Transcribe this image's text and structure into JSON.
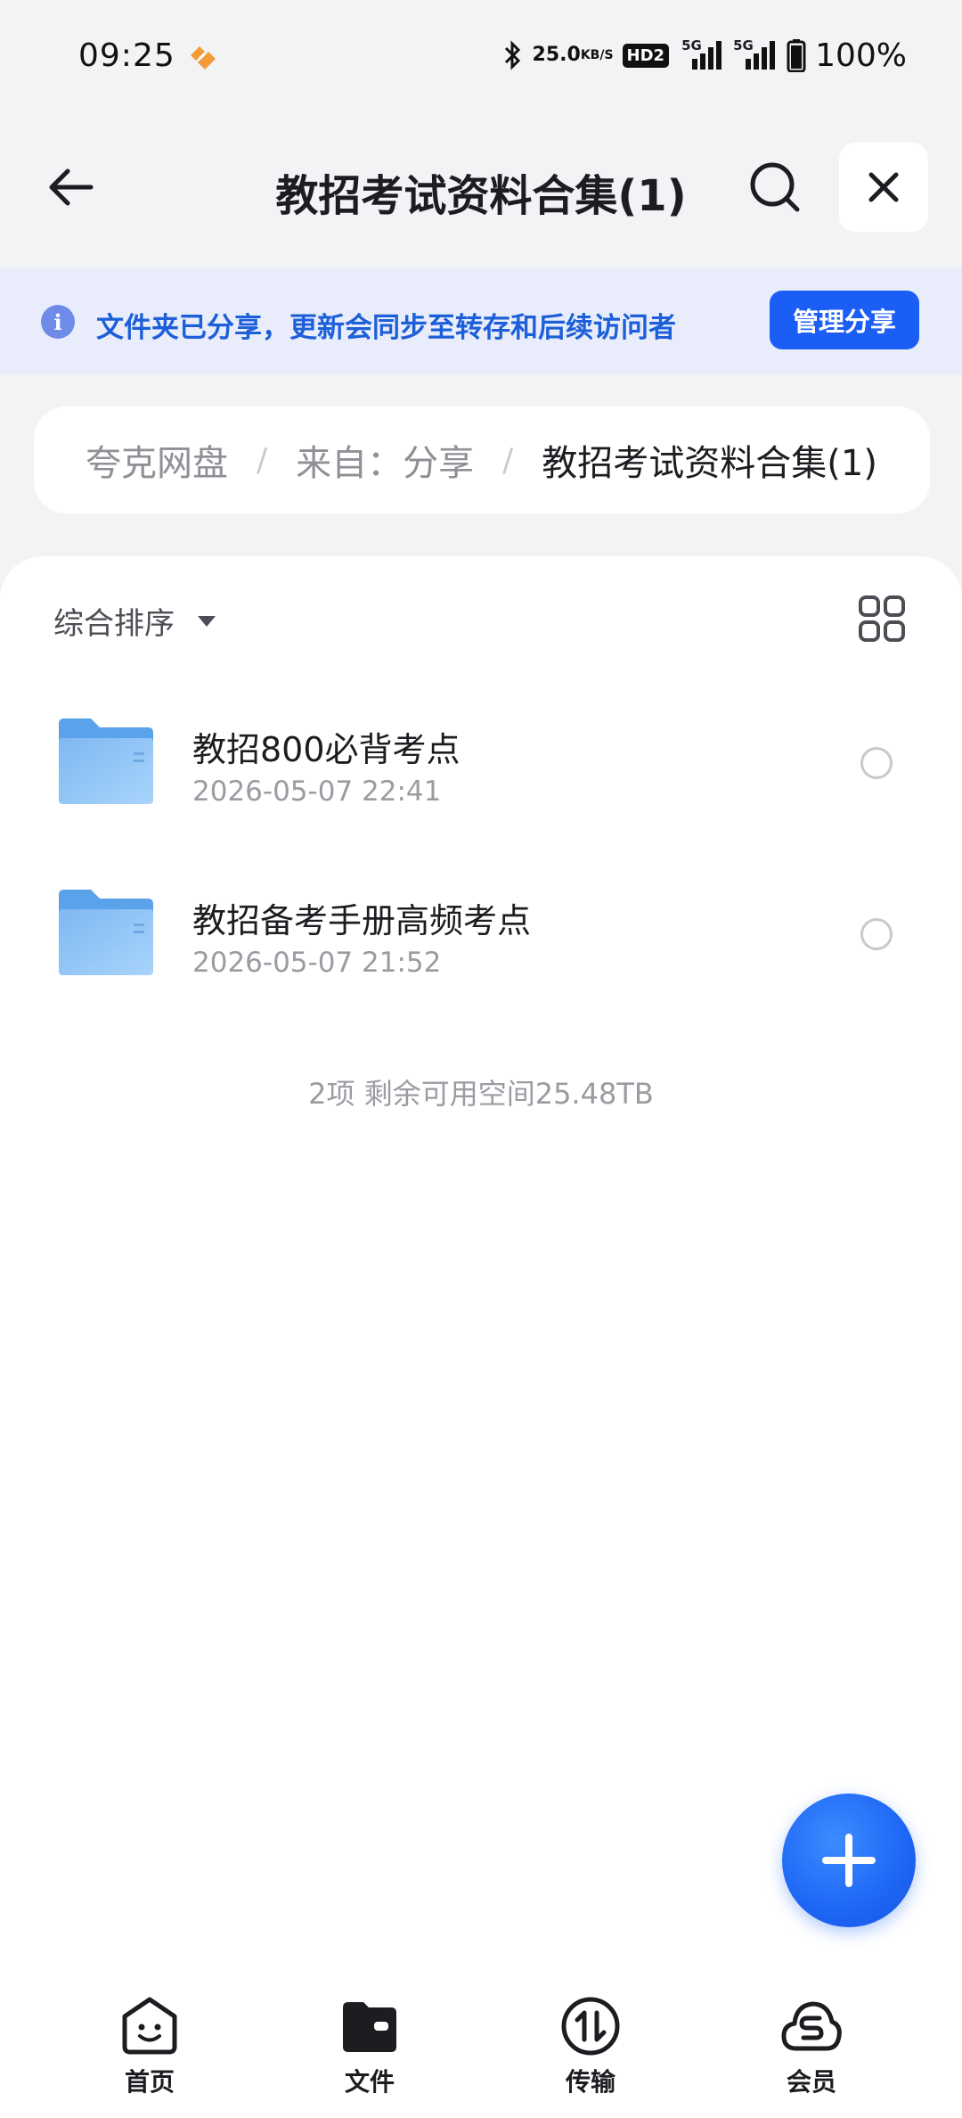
{
  "status_bar": {
    "time": "09:25",
    "speed_value": "25.0",
    "speed_unit": "KB/S",
    "hd_label": "HD2",
    "signal1_label": "5G",
    "signal2_label": "5G",
    "battery_text": "100%"
  },
  "header": {
    "title": "教招考试资料合集(1)"
  },
  "share_banner": {
    "text": "文件夹已分享，更新会同步至转存和后续访问者",
    "manage_label": "管理分享"
  },
  "breadcrumb": {
    "items": [
      "夸克网盘",
      "来自：分享",
      "教招考试资料合集(1)"
    ],
    "separator": "/"
  },
  "toolbar": {
    "sort_label": "综合排序"
  },
  "files": [
    {
      "name": "教招800必背考点",
      "date": "2026-05-07 22:41"
    },
    {
      "name": "教招备考手册高频考点",
      "date": "2026-05-07 21:52"
    }
  ],
  "summary": "2项 剩余可用空间25.48TB",
  "bottom_nav": [
    {
      "label": "首页",
      "icon": "home-face-icon"
    },
    {
      "label": "文件",
      "icon": "folder-wallet-icon"
    },
    {
      "label": "传输",
      "icon": "transfer-icon"
    },
    {
      "label": "会员",
      "icon": "cloud-member-icon"
    }
  ],
  "colors": {
    "accent": "#1b5ef5",
    "banner_bg": "#e9edfb",
    "banner_text": "#1d5fd8"
  }
}
